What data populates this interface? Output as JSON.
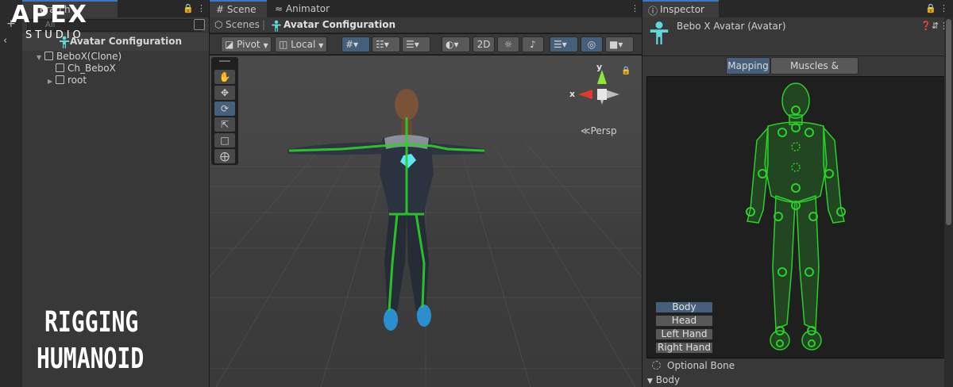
{
  "branding": {
    "logo": "APEX",
    "studio": "STUDIO",
    "title_line1": "RIGGING",
    "title_line2": "HUMANOID"
  },
  "hierarchy": {
    "tab_label": "erarch",
    "search_placeholder": "All",
    "header_label": "Avatar Configuration",
    "tree": [
      {
        "label": "BeboX(Clone)",
        "expanded": true,
        "level": 0
      },
      {
        "label": "Ch_BeboX",
        "expanded": false,
        "level": 1
      },
      {
        "label": "root",
        "expanded": false,
        "level": 1
      }
    ]
  },
  "scene": {
    "tabs": [
      {
        "label": "Scene",
        "icon": "grid-icon"
      },
      {
        "label": "Animator",
        "icon": "animator-icon"
      }
    ],
    "breadcrumb": {
      "root": "Scenes",
      "current": "Avatar Configuration"
    },
    "toolbar": {
      "pivot": "Pivot",
      "local": "Local",
      "toggle_2d": "2D"
    },
    "gizmo": {
      "x_label": "x",
      "y_label": "y",
      "projection": "Persp"
    }
  },
  "inspector": {
    "tab_label": "Inspector",
    "title": "Bebo X Avatar (Avatar)",
    "segments": {
      "mapping": "Mapping",
      "muscles": "Muscles & Settings"
    },
    "body_parts": [
      "Body",
      "Head",
      "Left Hand",
      "Right Hand"
    ],
    "selected_body_part": "Body",
    "optional_bone": "Optional Bone",
    "section": "Body"
  },
  "colors": {
    "accent": "#3a79bb",
    "bone_green": "#2bd02b",
    "avatar_icon": "#5fd8d8",
    "selected": "#46607c"
  }
}
